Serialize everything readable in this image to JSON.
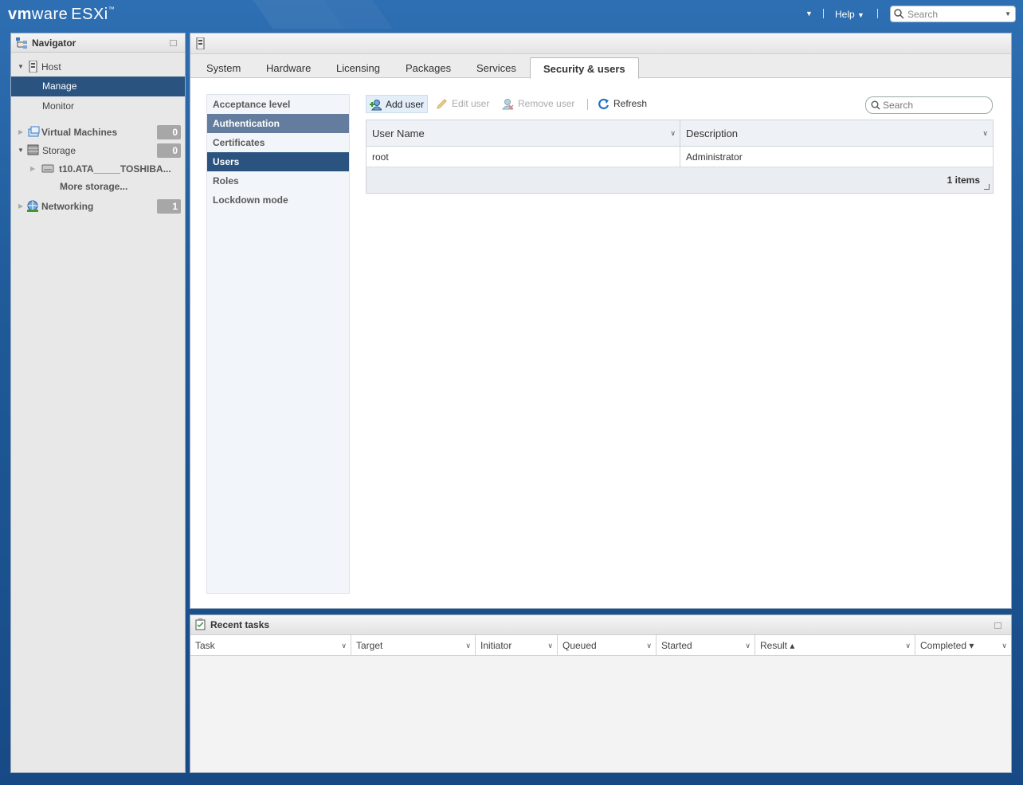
{
  "header": {
    "brand_vm": "vm",
    "brand_ware": "ware",
    "brand_product": "ESXi",
    "brand_tm": "™",
    "help_label": "Help",
    "search_placeholder": "Search"
  },
  "navigator": {
    "title": "Navigator",
    "host_label": "Host",
    "manage_label": "Manage",
    "monitor_label": "Monitor",
    "vms_label": "Virtual Machines",
    "vms_count": "0",
    "storage_label": "Storage",
    "storage_count": "0",
    "storage_device": "t10.ATA_____TOSHIBA...",
    "more_storage": "More storage...",
    "networking_label": "Networking",
    "networking_count": "1"
  },
  "tabs": [
    "System",
    "Hardware",
    "Licensing",
    "Packages",
    "Services",
    "Security & users"
  ],
  "active_tab": "Security & users",
  "subnav": [
    "Acceptance level",
    "Authentication",
    "Certificates",
    "Users",
    "Roles",
    "Lockdown mode"
  ],
  "toolbar": {
    "add_user": "Add user",
    "edit_user": "Edit user",
    "remove_user": "Remove user",
    "refresh": "Refresh",
    "search_placeholder": "Search"
  },
  "users_grid": {
    "columns": [
      "User Name",
      "Description"
    ],
    "rows": [
      [
        "root",
        "Administrator"
      ]
    ],
    "footer": "1 items"
  },
  "tasks": {
    "title": "Recent tasks",
    "columns": [
      "Task",
      "Target",
      "Initiator",
      "Queued",
      "Started",
      "Result ▴",
      "Completed ▾"
    ]
  }
}
